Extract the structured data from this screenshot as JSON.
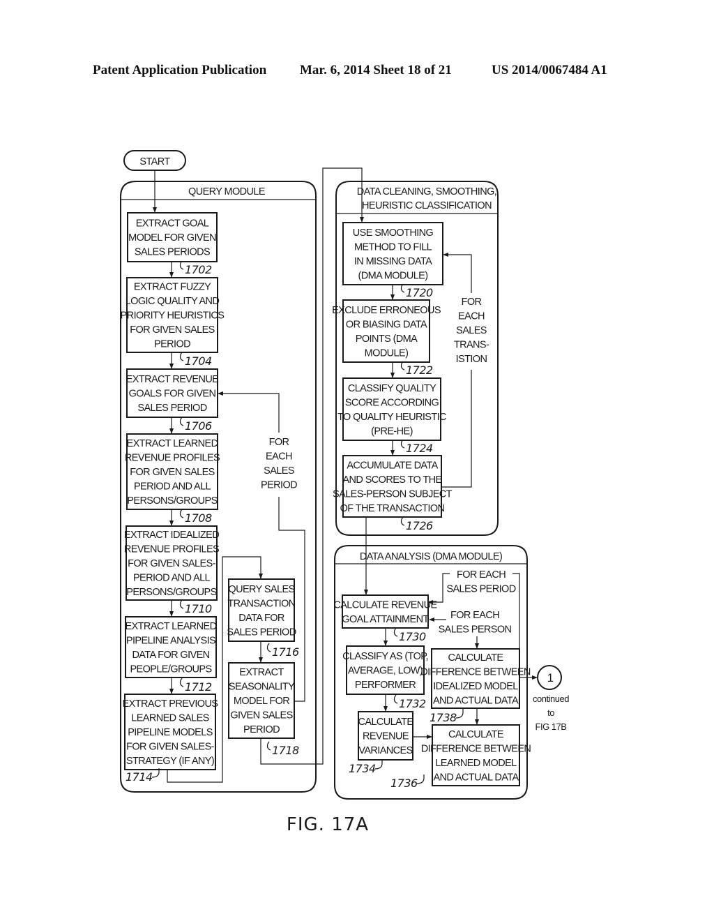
{
  "header": {
    "publication": "Patent Application Publication",
    "date_sheet": "Mar. 6, 2014   Sheet 18 of 21",
    "number": "US 2014/0067484 A1"
  },
  "start": {
    "label": "START"
  },
  "query_module": {
    "title": "QUERY MODULE",
    "steps": [
      {
        "ref": "1702",
        "lines": [
          "EXTRACT GOAL",
          "MODEL FOR GIVEN",
          "SALES PERIODS"
        ]
      },
      {
        "ref": "1704",
        "lines": [
          "EXTRACT FUZZY",
          "LOGIC QUALITY AND",
          "PRIORITY HEURISTICS",
          "FOR GIVEN SALES",
          "PERIOD"
        ]
      },
      {
        "ref": "1706",
        "lines": [
          "EXTRACT REVENUE",
          "GOALS FOR GIVEN",
          "SALES PERIOD"
        ]
      },
      {
        "ref": "1708",
        "lines": [
          "EXTRACT LEARNED",
          "REVENUE PROFILES",
          "FOR GIVEN SALES",
          "PERIOD AND ALL",
          "PERSONS/GROUPS"
        ]
      },
      {
        "ref": "1710",
        "lines": [
          "EXTRACT IDEALIZED",
          "REVENUE PROFILES",
          "FOR GIVEN SALES-",
          "PERIOD AND ALL",
          "PERSONS/GROUPS"
        ]
      },
      {
        "ref": "1712",
        "lines": [
          "EXTRACT LEARNED",
          "PIPELINE ANALYSIS",
          "DATA FOR GIVEN",
          "PEOPLE/GROUPS"
        ]
      },
      {
        "ref": "1714",
        "lines": [
          "EXTRACT PREVIOUS",
          "LEARNED SALES",
          "PIPELINE MODELS",
          "FOR GIVEN SALES-",
          "STRATEGY (IF ANY)"
        ]
      },
      {
        "ref": "1716",
        "lines": [
          "QUERY SALES",
          "TRANSACTION",
          "DATA FOR",
          "SALES PERIOD"
        ]
      },
      {
        "ref": "1718",
        "lines": [
          "EXTRACT",
          "SEASONALITY",
          "MODEL FOR",
          "GIVEN SALES",
          "PERIOD"
        ]
      }
    ],
    "loop_label": [
      "FOR",
      "EACH",
      "SALES",
      "PERIOD"
    ]
  },
  "cleaning_module": {
    "title": [
      "DATA CLEANING, SMOOTHING,",
      "HEURISTIC CLASSIFICATION"
    ],
    "steps": [
      {
        "ref": "1720",
        "lines": [
          "USE SMOOTHING",
          "METHOD TO FILL",
          "IN MISSING DATA",
          "(DMA MODULE)"
        ]
      },
      {
        "ref": "1722",
        "lines": [
          "EXCLUDE ERRONEOUS",
          "OR BIASING DATA",
          "POINTS (DMA",
          "MODULE)"
        ]
      },
      {
        "ref": "1724",
        "lines": [
          "CLASSIFY QUALITY",
          "SCORE ACCORDING",
          "TO QUALITY HEURISTIC",
          "(PRE-HE)"
        ]
      },
      {
        "ref": "1726",
        "lines": [
          "ACCUMULATE DATA",
          "AND SCORES TO THE",
          "SALES-PERSON SUBJECT",
          "OF THE TRANSACTION"
        ]
      }
    ],
    "loop_label": [
      "FOR",
      "EACH",
      "SALES",
      "TRANS-",
      "ISTION"
    ]
  },
  "analysis_module": {
    "title": "DATA ANALYSIS (DMA MODULE)",
    "steps": [
      {
        "ref": "1730",
        "lines": [
          "CALCULATE REVENUE",
          "GOAL ATTAINMENT"
        ]
      },
      {
        "ref": "1732",
        "lines": [
          "CLASSIFY AS (TOP,",
          "AVERAGE, LOW)",
          "PERFORMER"
        ]
      },
      {
        "ref": "1734",
        "lines": [
          "CALCULATE",
          "REVENUE",
          "VARIANCES"
        ]
      },
      {
        "ref": "1736",
        "lines": [
          "CALCULATE",
          "DIFFERENCE BETWEEN",
          "LEARNED MODEL",
          "AND ACTUAL DATA"
        ]
      },
      {
        "ref": "1738",
        "lines": [
          "CALCULATE",
          "DIFFERENCE BETWEEN",
          "IDEALIZED MODEL",
          "AND ACTUAL DATA"
        ]
      }
    ],
    "loop_period": [
      "FOR EACH",
      "SALES PERIOD"
    ],
    "loop_person": [
      "FOR EACH",
      "SALES PERSON"
    ]
  },
  "connector": {
    "label": "1",
    "caption": [
      "continued",
      "to",
      "FIG 17B"
    ]
  },
  "figure_label": "FIG. 17A"
}
